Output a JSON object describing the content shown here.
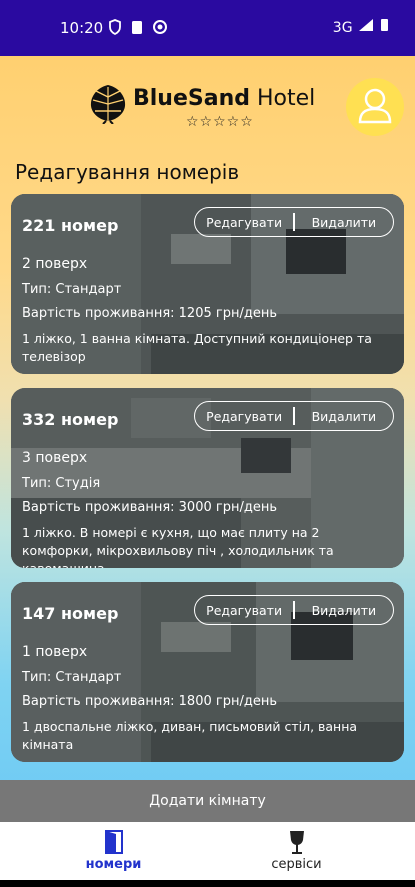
{
  "status_bar": {
    "time": "10:20",
    "network": "3G"
  },
  "header": {
    "brand_part1": "Blue",
    "brand_part2": "Sand",
    "brand_part3": " Hotel",
    "stars": "☆☆☆☆☆"
  },
  "page": {
    "title": "Редагування номерів"
  },
  "rooms": [
    {
      "number": "221 номер",
      "floor": "2 поверх",
      "type": "Тип: Стандарт",
      "price": "Вартість проживання: 1205 грн/день",
      "description": "1 ліжко, 1 ванна кімната. Доступний кондиціонер та телевізор"
    },
    {
      "number": "332 номер",
      "floor": "3 поверх",
      "type": "Тип: Студія",
      "price": "Вартість проживання: 3000 грн/день",
      "description": "1 ліжко. В номері є кухня, що має плиту на 2 комфорки, мікрохвильову піч , холодильник та кавомашина."
    },
    {
      "number": "147 номер",
      "floor": "1 поверх",
      "type": "Тип: Стандарт",
      "price": "Вартість проживання: 1800 грн/день",
      "description": "1 двоспальне ліжко, диван, письмовий стіл, ванна кімната"
    }
  ],
  "card_actions": {
    "edit": "Редагувати",
    "delete": "Видалити"
  },
  "add_button": {
    "label": "Додати кімнату"
  },
  "nav": {
    "rooms": "номери",
    "services": "сервіси",
    "active_color": "#2233cc"
  }
}
